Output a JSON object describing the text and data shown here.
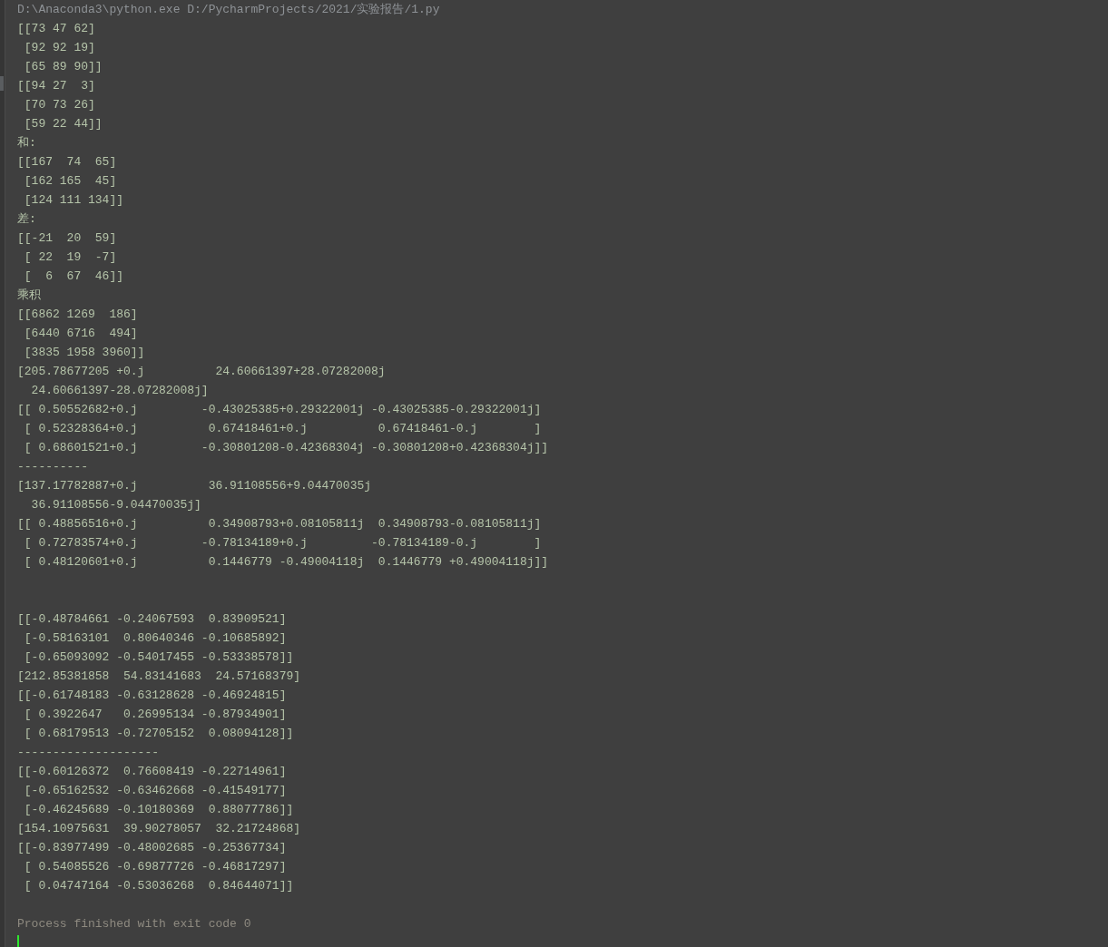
{
  "console": {
    "lines": [
      {
        "kind": "command",
        "text": "D:\\Anaconda3\\python.exe D:/PycharmProjects/2021/实验报告/1.py"
      },
      {
        "kind": "output",
        "text": "[[73 47 62]"
      },
      {
        "kind": "output",
        "text": " [92 92 19]"
      },
      {
        "kind": "output",
        "text": " [65 89 90]]"
      },
      {
        "kind": "output",
        "text": "[[94 27  3]"
      },
      {
        "kind": "output",
        "text": " [70 73 26]"
      },
      {
        "kind": "output",
        "text": " [59 22 44]]"
      },
      {
        "kind": "output",
        "text": "和:"
      },
      {
        "kind": "output",
        "text": "[[167  74  65]"
      },
      {
        "kind": "output",
        "text": " [162 165  45]"
      },
      {
        "kind": "output",
        "text": " [124 111 134]]"
      },
      {
        "kind": "output",
        "text": "差:"
      },
      {
        "kind": "output",
        "text": "[[-21  20  59]"
      },
      {
        "kind": "output",
        "text": " [ 22  19  -7]"
      },
      {
        "kind": "output",
        "text": " [  6  67  46]]"
      },
      {
        "kind": "output",
        "text": "乘积"
      },
      {
        "kind": "output",
        "text": "[[6862 1269  186]"
      },
      {
        "kind": "output",
        "text": " [6440 6716  494]"
      },
      {
        "kind": "output",
        "text": " [3835 1958 3960]]"
      },
      {
        "kind": "output",
        "text": "[205.78677205 +0.j          24.60661397+28.07282008j"
      },
      {
        "kind": "output",
        "text": "  24.60661397-28.07282008j]"
      },
      {
        "kind": "output",
        "text": "[[ 0.50552682+0.j         -0.43025385+0.29322001j -0.43025385-0.29322001j]"
      },
      {
        "kind": "output",
        "text": " [ 0.52328364+0.j          0.67418461+0.j          0.67418461-0.j        ]"
      },
      {
        "kind": "output",
        "text": " [ 0.68601521+0.j         -0.30801208-0.42368304j -0.30801208+0.42368304j]]"
      },
      {
        "kind": "output",
        "text": "----------"
      },
      {
        "kind": "output",
        "text": "[137.17782887+0.j          36.91108556+9.04470035j"
      },
      {
        "kind": "output",
        "text": "  36.91108556-9.04470035j]"
      },
      {
        "kind": "output",
        "text": "[[ 0.48856516+0.j          0.34908793+0.08105811j  0.34908793-0.08105811j]"
      },
      {
        "kind": "output",
        "text": " [ 0.72783574+0.j         -0.78134189+0.j         -0.78134189-0.j        ]"
      },
      {
        "kind": "output",
        "text": " [ 0.48120601+0.j          0.1446779 -0.49004118j  0.1446779 +0.49004118j]]"
      },
      {
        "kind": "blank"
      },
      {
        "kind": "blank"
      },
      {
        "kind": "output",
        "text": "[[-0.48784661 -0.24067593  0.83909521]"
      },
      {
        "kind": "output",
        "text": " [-0.58163101  0.80640346 -0.10685892]"
      },
      {
        "kind": "output",
        "text": " [-0.65093092 -0.54017455 -0.53338578]]"
      },
      {
        "kind": "output",
        "text": "[212.85381858  54.83141683  24.57168379]"
      },
      {
        "kind": "output",
        "text": "[[-0.61748183 -0.63128628 -0.46924815]"
      },
      {
        "kind": "output",
        "text": " [ 0.3922647   0.26995134 -0.87934901]"
      },
      {
        "kind": "output",
        "text": " [ 0.68179513 -0.72705152  0.08094128]]"
      },
      {
        "kind": "output",
        "text": "--------------------"
      },
      {
        "kind": "output",
        "text": "[[-0.60126372  0.76608419 -0.22714961]"
      },
      {
        "kind": "output",
        "text": " [-0.65162532 -0.63462668 -0.41549177]"
      },
      {
        "kind": "output",
        "text": " [-0.46245689 -0.10180369  0.88077786]]"
      },
      {
        "kind": "output",
        "text": "[154.10975631  39.90278057  32.21724868]"
      },
      {
        "kind": "output",
        "text": "[[-0.83977499 -0.48002685 -0.25367734]"
      },
      {
        "kind": "output",
        "text": " [ 0.54085526 -0.69877726 -0.46817297]"
      },
      {
        "kind": "output",
        "text": " [ 0.04747164 -0.53036268  0.84644071]]"
      },
      {
        "kind": "blank"
      },
      {
        "kind": "exit",
        "text": "Process finished with exit code 0"
      },
      {
        "kind": "cursor"
      }
    ]
  }
}
